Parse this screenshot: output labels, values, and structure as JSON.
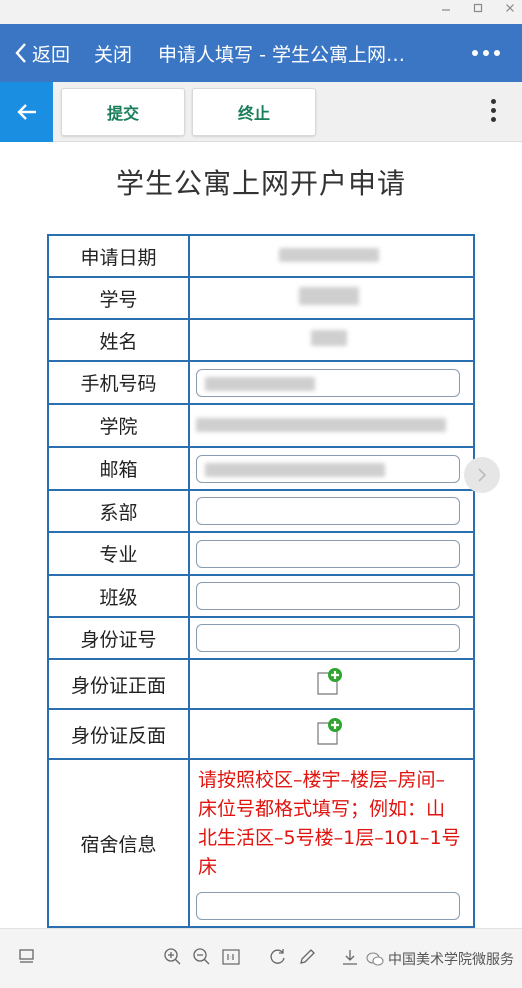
{
  "window": {
    "controls": [
      "minimize",
      "maximize",
      "close"
    ]
  },
  "nav": {
    "back_label": "返回",
    "close_label": "关闭",
    "title": "申请人填写 - 学生公寓上网…"
  },
  "toolbar": {
    "submit_label": "提交",
    "stop_label": "终止"
  },
  "form": {
    "title": "学生公寓上网开户申请",
    "rows": [
      {
        "label": "申请日期"
      },
      {
        "label": "学号"
      },
      {
        "label": "姓名"
      },
      {
        "label": "手机号码"
      },
      {
        "label": "学院"
      },
      {
        "label": "邮箱"
      },
      {
        "label": "系部"
      },
      {
        "label": "专业"
      },
      {
        "label": "班级"
      },
      {
        "label": "身份证号"
      },
      {
        "label": "身份证正面"
      },
      {
        "label": "身份证反面"
      },
      {
        "label": "宿舍信息"
      }
    ],
    "dorm_instructions": "请按照校区–楼宇–楼层–房间–床位号都格式填写；例如：山北生活区–5号楼–1层–101–1号床"
  },
  "bottom_bar": {
    "watermark": "中国美术学院微服务"
  },
  "colors": {
    "nav_bg": "#3a76c4",
    "accent_blue": "#1a8ee0",
    "button_text": "#1a7e5a",
    "note_red": "#e0140f",
    "table_border": "#2a6fb0"
  }
}
